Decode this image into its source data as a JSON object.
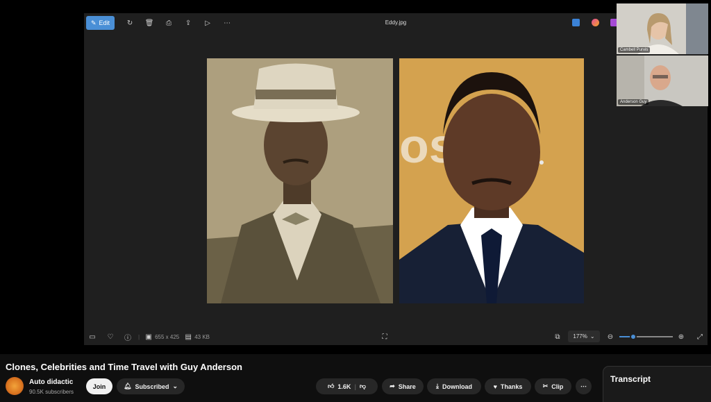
{
  "viewer": {
    "edit_label": "Edit",
    "filename": "Eddy.jpg",
    "image_dims": "655 x 425",
    "file_size": "43 KB",
    "zoom": "177%",
    "zoom_level": 0.26
  },
  "participants": [
    {
      "name": "Cambell Purvis"
    },
    {
      "name": "Anderson Guy"
    }
  ],
  "video": {
    "title": "Clones, Celebrities and Time Travel with Guy Anderson"
  },
  "channel": {
    "name": "Auto didactic",
    "subscribers": "90.5K subscribers",
    "join_label": "Join",
    "subscribed_label": "Subscribed"
  },
  "actions": {
    "likes": "1.6K",
    "share": "Share",
    "download": "Download",
    "thanks": "Thanks",
    "clip": "Clip"
  },
  "transcript": {
    "title": "Transcript"
  },
  "colors": {
    "accent": "#4a8fd6",
    "background": "#0f0f0f"
  }
}
